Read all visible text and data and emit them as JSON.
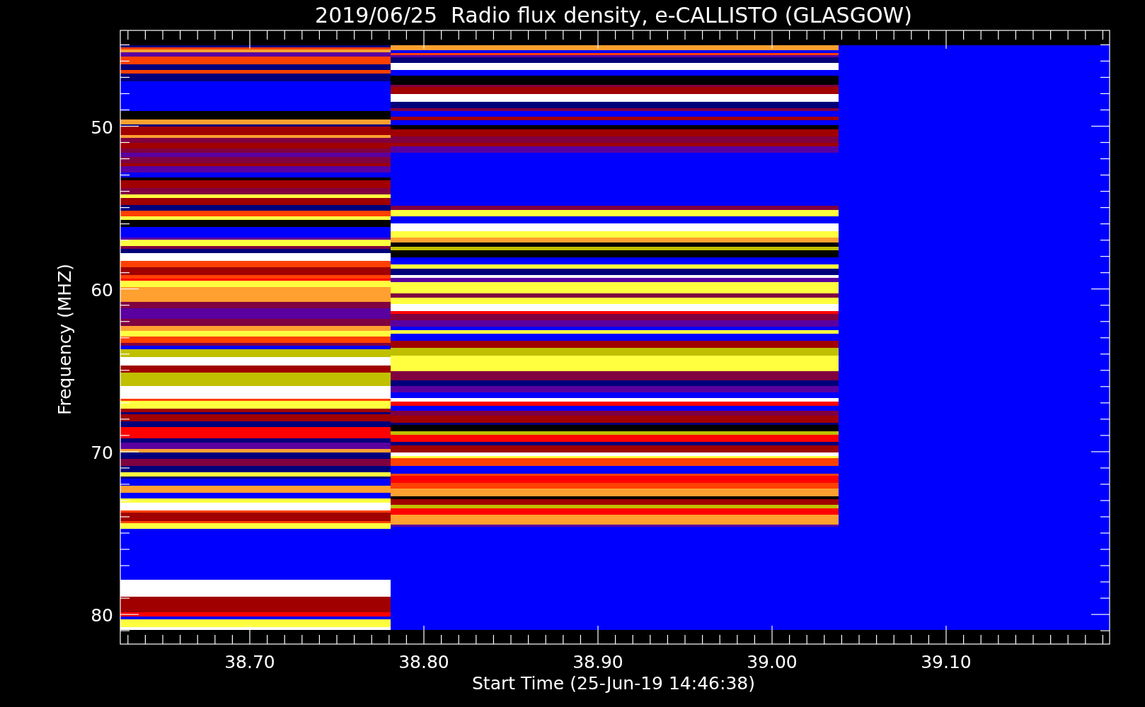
{
  "title": "2019/06/25  Radio flux density, e-CALLISTO (GLASGOW)",
  "y_axis": {
    "label": "Frequency (MHZ)",
    "ticks": [
      "50",
      "60",
      "70",
      "80"
    ]
  },
  "x_axis": {
    "label": "Start Time (25-Jun-19 14:46:38)",
    "ticks": [
      "38.70",
      "38.80",
      "38.90",
      "39.00",
      "39.10"
    ]
  }
}
